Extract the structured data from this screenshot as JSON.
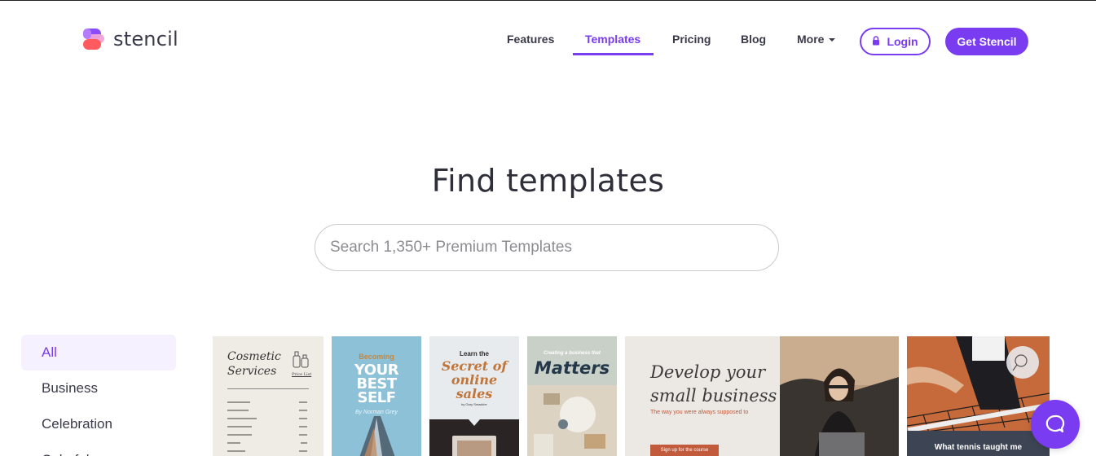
{
  "brand": {
    "name": "stencil",
    "accent": "#7a3cf0"
  },
  "nav": {
    "items": [
      {
        "label": "Features"
      },
      {
        "label": "Templates"
      },
      {
        "label": "Pricing"
      },
      {
        "label": "Blog"
      },
      {
        "label": "More"
      }
    ],
    "active": "Templates",
    "login_label": "Login",
    "cta_label": "Get Stencil"
  },
  "hero": {
    "title": "Find templates",
    "search_placeholder": "Search 1,350+ Premium Templates"
  },
  "categories": [
    {
      "label": "All",
      "active": true
    },
    {
      "label": "Business",
      "active": false
    },
    {
      "label": "Celebration",
      "active": false
    },
    {
      "label": "Colorful",
      "active": false
    }
  ],
  "templates": [
    {
      "title": "Cosmetic Services",
      "subtitle": "Price List"
    },
    {
      "title_top": "Becoming",
      "title_main": "YOUR BEST SELF",
      "byline": "By Norman Grey"
    },
    {
      "kicker": "Learn the",
      "title": "Secret of online sales",
      "byline": "by Gary Smackler"
    },
    {
      "kicker": "Creating a business that",
      "title": "Matters"
    },
    {
      "title": "Develop your small business",
      "subtitle": "The way you were always supposed to",
      "cta": "Sign up for the course"
    },
    {
      "title": "What tennis taught me"
    }
  ],
  "chat": {
    "icon": "chat-bubble-icon"
  }
}
